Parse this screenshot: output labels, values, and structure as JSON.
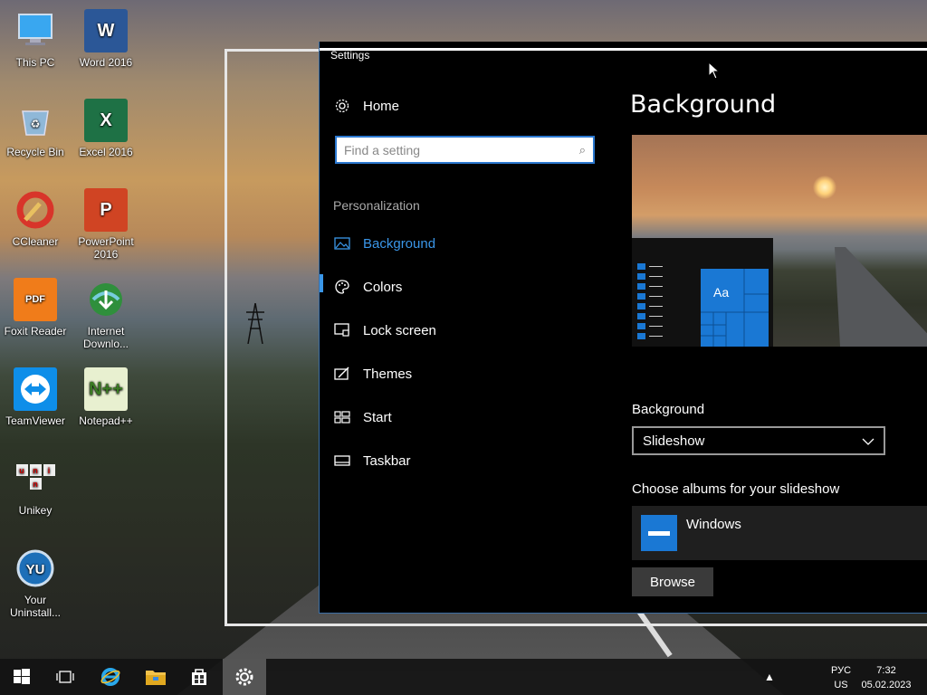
{
  "desktop": {
    "icons": [
      {
        "label": "This PC"
      },
      {
        "label": "Word 2016"
      },
      {
        "label": "Recycle Bin"
      },
      {
        "label": "Excel 2016"
      },
      {
        "label": "CCleaner"
      },
      {
        "label": "PowerPoint 2016"
      },
      {
        "label": "Foxit Reader"
      },
      {
        "label": "Internet Downlo..."
      },
      {
        "label": "TeamViewer"
      },
      {
        "label": "Notepad++"
      },
      {
        "label": "Unikey"
      },
      {
        "label": "Your Uninstall..."
      }
    ]
  },
  "settings": {
    "window_title": "Settings",
    "home_label": "Home",
    "search_placeholder": "Find a setting",
    "section": "Personalization",
    "nav": [
      {
        "label": "Background",
        "icon": "picture-icon"
      },
      {
        "label": "Colors",
        "icon": "palette-icon"
      },
      {
        "label": "Lock screen",
        "icon": "lock-screen-icon"
      },
      {
        "label": "Themes",
        "icon": "themes-icon"
      },
      {
        "label": "Start",
        "icon": "start-icon"
      },
      {
        "label": "Taskbar",
        "icon": "taskbar-icon"
      }
    ],
    "page_title": "Background",
    "preview_tile_text": "Aa",
    "background_label": "Background",
    "background_value": "Slideshow",
    "albums_label": "Choose albums for your slideshow",
    "album_name": "Windows",
    "browse_label": "Browse",
    "accent_color": "#1a78d4"
  },
  "taskbar": {
    "language_top": "РУС",
    "language_bottom": "US",
    "time": "7:32",
    "date": "05.02.2023"
  }
}
